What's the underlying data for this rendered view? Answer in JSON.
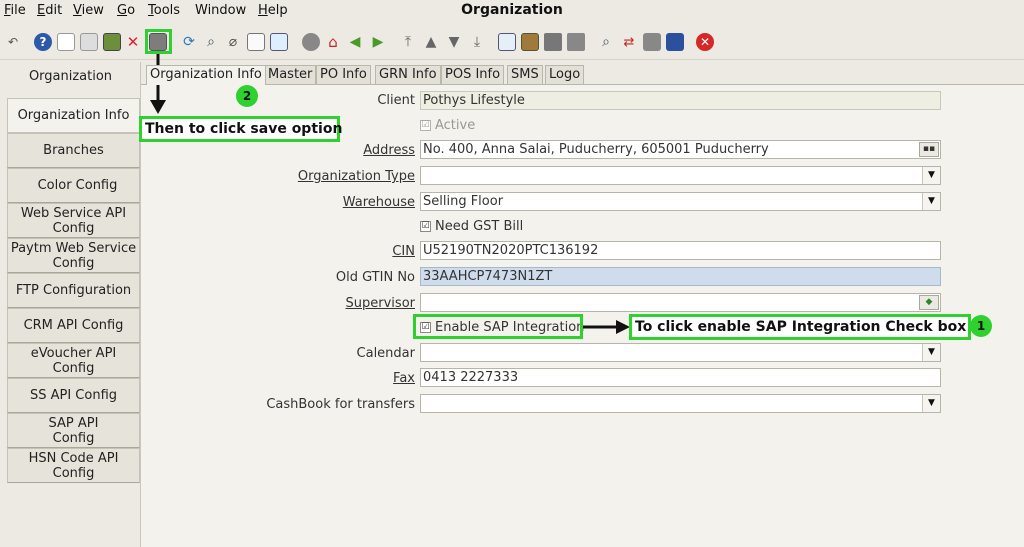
{
  "window": {
    "title": "Organization"
  },
  "menu": [
    {
      "label": "File",
      "key": "F",
      "rest": "ile"
    },
    {
      "label": "Edit",
      "key": "E",
      "rest": "dit"
    },
    {
      "label": "View",
      "key": "V",
      "rest": "iew"
    },
    {
      "label": "Go",
      "key": "G",
      "rest": "o"
    },
    {
      "label": "Tools",
      "key": "T",
      "rest": "ools"
    },
    {
      "label": "Window",
      "key": "",
      "rest": "Window"
    },
    {
      "label": "Help",
      "key": "H",
      "rest": "elp"
    }
  ],
  "sidebar": {
    "header": "Organization",
    "items": [
      "Organization Info",
      "Branches",
      "Color Config",
      "Web Service API Config",
      "Paytm Web Service Config",
      "FTP Configuration",
      "CRM API Config",
      "eVoucher API Config",
      "SS API Config",
      "SAP API Config",
      "HSN Code API Config"
    ]
  },
  "tabs": [
    "Organization Info",
    "Master",
    "PO Info",
    "GRN Info",
    "POS Info",
    "SMS",
    "Logo"
  ],
  "form": {
    "client": {
      "label": "Client",
      "value": "Pothys Lifestyle"
    },
    "active": {
      "label": "Active",
      "checked": "☑"
    },
    "address": {
      "label": "Address",
      "value": "No. 400, Anna Salai, Puducherry,  605001 Puducherry"
    },
    "org_type": {
      "label": "Organization Type",
      "value": ""
    },
    "warehouse": {
      "label": "Warehouse",
      "value": "Selling Floor"
    },
    "need_gst": {
      "label": "Need GST Bill",
      "checked": "☑"
    },
    "cin": {
      "label": "CIN",
      "value": "U52190TN2020PTC136192"
    },
    "old_gtin": {
      "label": "Old GTIN No",
      "value": "33AAHCP7473N1ZT"
    },
    "supervisor": {
      "label": "Supervisor",
      "value": ""
    },
    "enable_sap": {
      "label": "Enable SAP Integration",
      "checked": "☑"
    },
    "calendar": {
      "label": "Calendar",
      "value": ""
    },
    "fax": {
      "label": "Fax",
      "value": "0413 2227333"
    },
    "cashbook": {
      "label": "CashBook for transfers",
      "value": ""
    }
  },
  "annotations": {
    "step1_num": "1",
    "step1_text": "To click  enable SAP Integration Check box",
    "step2_num": "2",
    "step2_text": "Then to click save option"
  },
  "colors": {
    "annotation": "#2fd12f",
    "window_bg": "#eceae3",
    "panel_bg": "#f4f2ec"
  }
}
